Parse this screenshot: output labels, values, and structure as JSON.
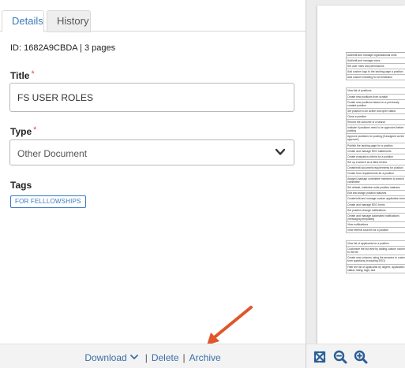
{
  "tabs": [
    {
      "label": "Details",
      "active": true
    },
    {
      "label": "History",
      "active": false
    }
  ],
  "meta": {
    "id_line": "ID: 1682A9CBDA | 3 pages"
  },
  "form": {
    "title_label": "Title",
    "title_required": "*",
    "title_value": "FS USER ROLES",
    "type_label": "Type",
    "type_required": "*",
    "type_value": "Other Document",
    "tags_label": "Tags",
    "tags": [
      "FOR FELLLOWSHIPS"
    ]
  },
  "footer": {
    "download_label": "Download",
    "sep1": "|",
    "delete_label": "Delete",
    "sep2": "|",
    "archive_label": "Archive"
  },
  "colors": {
    "accent": "#3a7bbf",
    "required": "#d9534f",
    "arrow": "#e0562c"
  },
  "icons": {
    "zoom_fit": "fit-screen-icon",
    "zoom_out": "zoom-out-icon",
    "zoom_in": "zoom-in-icon",
    "dropdown": "chevron-down-icon"
  },
  "preview": {
    "rows": [
      "Add/edit and manage organizational units",
      "Add/edit and manage users",
      "Set user roles and permissions",
      "Add custom logo to the landing page a position",
      "Add custom branding for an institution",
      "",
      "View list of positions",
      "Create new positions from scratch",
      "Create new positions based on a previously created position",
      "Set position to an active and open status",
      "Close a position",
      "Record the outcome of a search",
      "Indicate if positions need to be approved before posting",
      "Approve positions for posting (if assigned as the approver)",
      "Publish the landing page for a position",
      "Create and manage EEO statements",
      "Create evaluation criteria for a position",
      "Set up a search as a blind review",
      "Create/edit document requirements for position",
      "Create form requirements for a position",
      "Assign/Unassign committee members to search committee",
      "Set default, institution-wide position statuses",
      "Edit and assign position statuses",
      "Create/edit and manage custom application forms",
      "Create and manage EEO forms",
      "Set position change notifications",
      "Create and manage automated notifications (messaging templates)",
      "View notifications",
      "View referral sources for a position",
      "",
      "View list of applicants for a position",
      "Customize the list view by adding custom columns to the list",
      "Create new columns using the answers to custom form questions (excluding EEO)",
      "Filter the list of applicants by degree, application status, rating, tags, and"
    ]
  }
}
